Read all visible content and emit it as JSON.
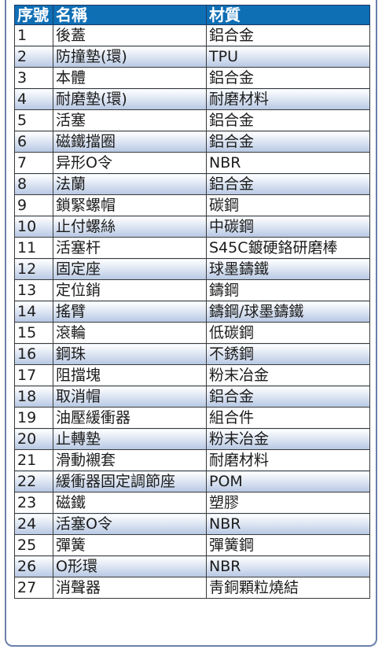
{
  "table": {
    "headers": [
      "序號",
      "名稱",
      "材質"
    ],
    "rows": [
      {
        "no": "1",
        "name": "後蓋",
        "material": "鋁合金"
      },
      {
        "no": "2",
        "name": "防撞墊(環)",
        "material": "TPU"
      },
      {
        "no": "3",
        "name": "本體",
        "material": "鋁合金"
      },
      {
        "no": "4",
        "name": "耐磨墊(環)",
        "material": "耐磨材料"
      },
      {
        "no": "5",
        "name": "活塞",
        "material": "鋁合金"
      },
      {
        "no": "6",
        "name": "磁鐵擋圈",
        "material": "鋁合金"
      },
      {
        "no": "7",
        "name": "异形O令",
        "material": "NBR"
      },
      {
        "no": "8",
        "name": "法蘭",
        "material": "鋁合金"
      },
      {
        "no": "9",
        "name": "鎖緊螺帽",
        "material": "碳鋼"
      },
      {
        "no": "10",
        "name": "止付螺絲",
        "material": "中碳鋼"
      },
      {
        "no": "11",
        "name": "活塞杆",
        "material": "S45C鍍硬鉻研磨棒"
      },
      {
        "no": "12",
        "name": "固定座",
        "material": "球墨鑄鐵"
      },
      {
        "no": "13",
        "name": "定位銷",
        "material": "鑄鋼"
      },
      {
        "no": "14",
        "name": "搖臂",
        "material": "鑄鋼/球墨鑄鐵"
      },
      {
        "no": "15",
        "name": "滾輪",
        "material": "低碳鋼"
      },
      {
        "no": "16",
        "name": "鋼珠",
        "material": "不銹鋼"
      },
      {
        "no": "17",
        "name": "阻擋塊",
        "material": "粉末冶金"
      },
      {
        "no": "18",
        "name": "取消帽",
        "material": "鋁合金"
      },
      {
        "no": "19",
        "name": "油壓緩衝器",
        "material": "組合件"
      },
      {
        "no": "20",
        "name": "止轉墊",
        "material": "粉末冶金"
      },
      {
        "no": "21",
        "name": "滑動襯套",
        "material": "耐磨材料"
      },
      {
        "no": "22",
        "name": "緩衝器固定調節座",
        "material": "POM"
      },
      {
        "no": "23",
        "name": "磁鐵",
        "material": "塑膠"
      },
      {
        "no": "24",
        "name": "活塞O令",
        "material": "NBR"
      },
      {
        "no": "25",
        "name": "彈簧",
        "material": "彈簧鋼"
      },
      {
        "no": "26",
        "name": "O形環",
        "material": "NBR"
      },
      {
        "no": "27",
        "name": "消聲器",
        "material": "靑銅顆粒燒結"
      }
    ]
  },
  "colors": {
    "header_bg": "#0f6fb5",
    "header_text": "#ffffff",
    "row_shade_bottom": "#b7c8e3",
    "frame_border": "#6a80ad"
  }
}
